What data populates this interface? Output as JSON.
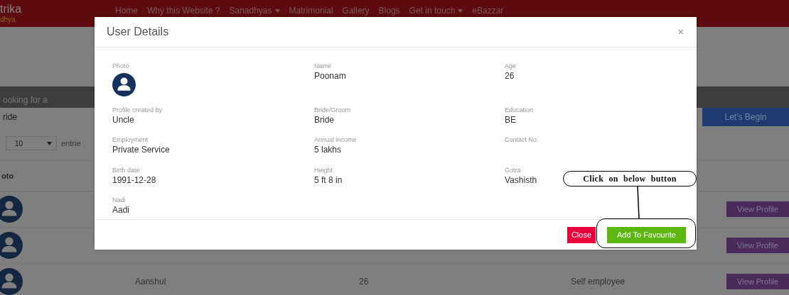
{
  "header": {
    "brand": "trika",
    "tagline": "dhya",
    "nav": [
      {
        "label": "Home",
        "dropdown": false
      },
      {
        "label": "Why this Website ?",
        "dropdown": false
      },
      {
        "label": "Sanadhyas",
        "dropdown": true
      },
      {
        "label": "Matrimonial",
        "dropdown": false
      },
      {
        "label": "Gallery",
        "dropdown": false
      },
      {
        "label": "Blogs",
        "dropdown": false
      },
      {
        "label": "Get in touch",
        "dropdown": true
      },
      {
        "label": "eBazzar",
        "dropdown": false
      }
    ]
  },
  "search": {
    "label": "ooking for a",
    "value": "ride",
    "button": "Let's Begin"
  },
  "entries": {
    "value": "10",
    "label": "entrie"
  },
  "table": {
    "columns": [
      "oto"
    ],
    "rows": [
      {
        "action": "View Profile"
      },
      {
        "action": "View Profile"
      },
      {
        "name": "Aanshul",
        "age": "26",
        "employment": "Self employee",
        "action": "View Profile"
      }
    ]
  },
  "modal": {
    "title": "User Details",
    "close": "×",
    "fields": [
      {
        "kind": "photo",
        "label": "Photo"
      },
      {
        "kind": "text",
        "label": "Name",
        "value": "Poonam"
      },
      {
        "kind": "text",
        "label": "Age",
        "value": "26"
      },
      {
        "kind": "text",
        "label": "Profile created by",
        "value": "Uncle"
      },
      {
        "kind": "text",
        "label": "Bride/Groom",
        "value": "Bride"
      },
      {
        "kind": "text",
        "label": "Education",
        "value": "BE"
      },
      {
        "kind": "text",
        "label": "Employment",
        "value": "Private Service"
      },
      {
        "kind": "text",
        "label": "Annual income",
        "value": "5 lakhs"
      },
      {
        "kind": "text",
        "label": "Contact No."
      },
      {
        "kind": "text",
        "label": "Birth date",
        "value": "1991-12-28"
      },
      {
        "kind": "text",
        "label": "Height",
        "value": "5 ft 8 in"
      },
      {
        "kind": "text",
        "label": "Gotra",
        "value": "Vashisth"
      },
      {
        "kind": "text",
        "label": "Nadi",
        "value": "Aadi"
      }
    ],
    "buttons": [
      {
        "kind": "danger",
        "label": "Close"
      },
      {
        "kind": "success",
        "label": "Add To Favourite"
      }
    ]
  },
  "annotation": {
    "text": "Click on below button"
  }
}
